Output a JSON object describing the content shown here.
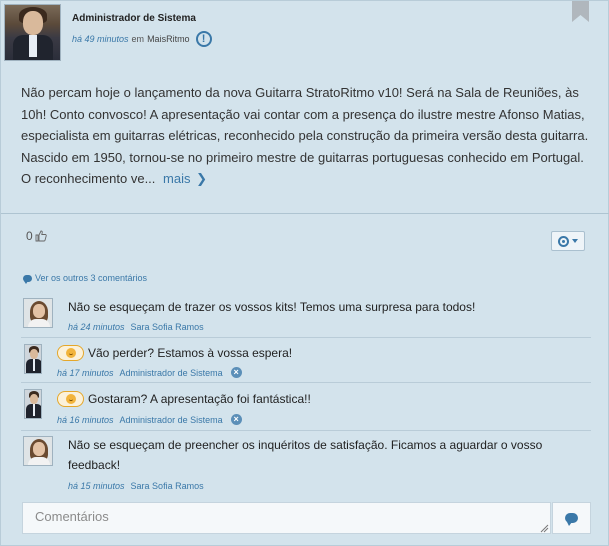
{
  "post": {
    "author": "Administrador de Sistema",
    "time": "há 49 minutos",
    "in_word": "em",
    "group": "MaisRitmo",
    "body": "Não percam hoje o lançamento da nova Guitarra StratoRitmo v10! Será na Sala de Reuniões, às 10h! Conto convosco! A apresentação vai contar com a presença do ilustre mestre Afonso Matias, especialista em guitarras elétricas, reconhecido pela construção da primeira versão desta guitarra. Nascido em 1950, tornou-se no primeiro mestre de guitarras portuguesas conhecido em Portugal. O reconhecimento ve...",
    "more_label": "mais",
    "likes": "0"
  },
  "see_comments_label": "Ver os outros 3 comentários",
  "comments": [
    {
      "text": "Não se esqueçam de trazer os vossos kits! Temos uma surpresa para todos!",
      "time": "há 24 minutos",
      "author": "Sara Sofia Ramos"
    },
    {
      "text": "Vão perder? Estamos à vossa espera!",
      "time": "há 17 minutos",
      "author": "Administrador de Sistema"
    },
    {
      "text": "Gostaram? A apresentação foi fantástica!!",
      "time": "há 16 minutos",
      "author": "Administrador de Sistema"
    },
    {
      "text": "Não se esqueçam de preencher os inquéritos de satisfação. Ficamos a aguardar o vosso feedback!",
      "time": "há 15 minutos",
      "author": "Sara Sofia Ramos"
    }
  ],
  "comment_input": {
    "placeholder": "Comentários"
  },
  "icons": {
    "info": "!",
    "delete": "×"
  },
  "colors": {
    "background": "#d3e3ec",
    "accent": "#3a78a8",
    "bookmark": "#b0b7bd",
    "emoji": "#f2b43c"
  }
}
